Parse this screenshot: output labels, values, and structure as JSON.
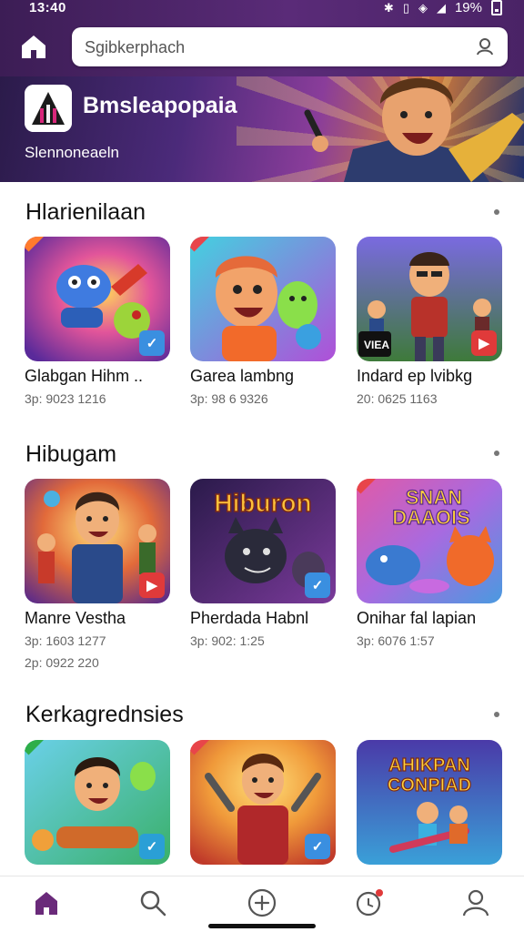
{
  "status_bar": {
    "time": "13:40",
    "battery": "19%",
    "icons": [
      "bluetooth-icon",
      "vibrate-icon",
      "wifi-icon",
      "signal-icon",
      "battery-icon"
    ]
  },
  "header": {
    "search_placeholder": "Sgibkerphach",
    "home_icon": "home-icon",
    "search_icon": "account-search-icon"
  },
  "banner": {
    "title": "Bmsleapopaia",
    "subtitle": "Slennoneaeln"
  },
  "sections": [
    {
      "title": "Hlarienilaan",
      "cards": [
        {
          "name": "Glabgan Hihm ..",
          "meta": "3p: 9023 1216",
          "ribbon": "#ff7b2e",
          "badge": "#3a8fe0",
          "badge_icon": "check-icon"
        },
        {
          "name": "Garea lambng",
          "meta": "3p: 98 6 9326",
          "ribbon": "#e8454a",
          "badge": "",
          "badge_icon": ""
        },
        {
          "name": "Indard ep lvibkg",
          "meta": "20: 0625 1163",
          "ribbon": "",
          "badge": "#e03a3a",
          "badge_icon": "play-icon"
        }
      ]
    },
    {
      "title": "Hibugam",
      "cards": [
        {
          "name": "Manre Vestha",
          "meta": "3p: 1603 1277",
          "meta2": "2p: 0922 220",
          "ribbon": "",
          "badge": "#e03a3a",
          "badge_icon": "play-icon"
        },
        {
          "name": "Pherdada Habnl",
          "meta": "3p: 902: 1:25",
          "ribbon": "",
          "badge": "#3a8fe0",
          "badge_icon": "check-icon"
        },
        {
          "name": "Onihar fal lapian",
          "meta": "3p: 6076 1:57",
          "ribbon": "#e8454a",
          "badge": "",
          "badge_icon": ""
        }
      ]
    },
    {
      "title": "Kerkagrednsies",
      "cards": [
        {
          "name": "",
          "meta": "",
          "ribbon": "#2eae4a",
          "badge": "#2a9fd6",
          "badge_icon": "check-icon"
        },
        {
          "name": "",
          "meta": "",
          "ribbon": "#e8454a",
          "badge": "#3a8fe0",
          "badge_icon": "check-icon"
        },
        {
          "name": "",
          "meta": "",
          "ribbon": "",
          "badge": "",
          "badge_icon": ""
        }
      ]
    }
  ],
  "thumb_text": {
    "card_1_3": "VIEA",
    "card_2_2": "Hiburon",
    "card_2_3_line1": "SNAN",
    "card_2_3_line2": "DAAOIS",
    "card_3_3_line1": "AHIKPAN",
    "card_3_3_line2": "CONPIAD"
  },
  "bottom_nav": [
    "home-icon",
    "search-icon",
    "add-circle-icon",
    "notifications-icon",
    "profile-icon"
  ],
  "colors": {
    "accent": "#5a2b78",
    "nav_active": "#6a2a7a"
  }
}
